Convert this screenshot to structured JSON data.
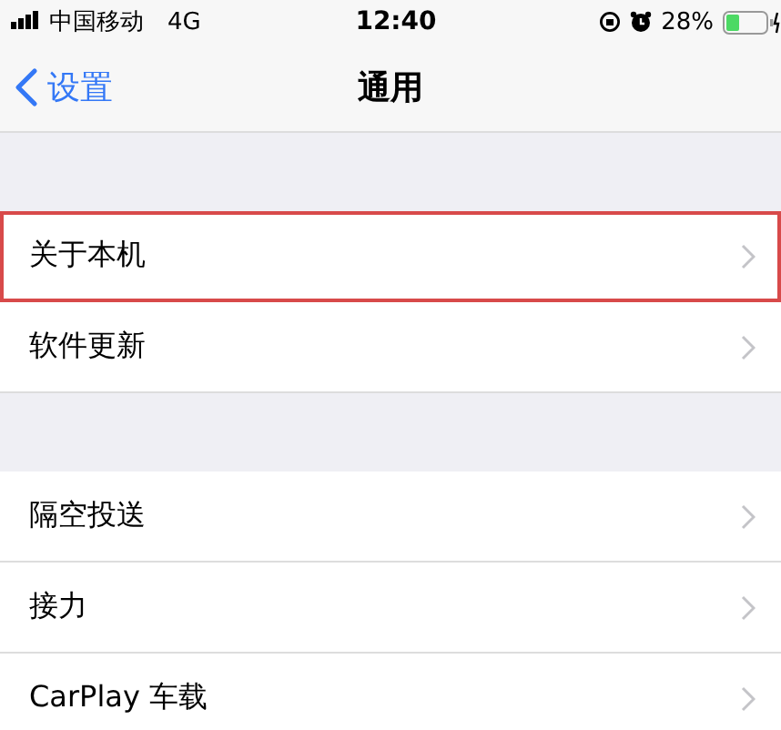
{
  "status_bar": {
    "carrier": "中国移动",
    "network": "4G",
    "time": "12:40",
    "battery": "28%"
  },
  "nav_bar": {
    "back": "设置",
    "title": "通用"
  },
  "groups": [
    {
      "items": [
        {
          "label": "关于本机",
          "highlighted": true
        },
        {
          "label": "软件更新",
          "highlighted": false
        }
      ]
    },
    {
      "items": [
        {
          "label": "隔空投送",
          "highlighted": false
        },
        {
          "label": "接力",
          "highlighted": false
        },
        {
          "label": "CarPlay 车载",
          "highlighted": false
        }
      ]
    }
  ]
}
